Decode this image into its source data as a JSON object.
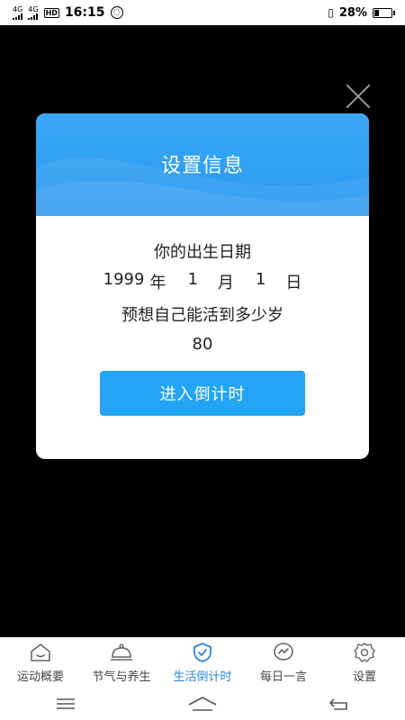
{
  "status_bar": {
    "network_1": "4G",
    "network_2": "4G",
    "hd_label": "HD",
    "time": "16:15",
    "battery_percent": "28%",
    "battery_level": 0.28
  },
  "dialog": {
    "title": "设置信息",
    "birth_label": "你的出生日期",
    "birth_year": "1999",
    "year_unit": "年",
    "birth_month": "1",
    "month_unit": "月",
    "birth_day": "1",
    "day_unit": "日",
    "age_label": "预想自己能活到多少岁",
    "age_value": "80",
    "enter_button": "进入倒计时"
  },
  "tabs": [
    {
      "label": "运动概要",
      "icon": "house-smile-icon",
      "active": false
    },
    {
      "label": "节气与养生",
      "icon": "cloche-icon",
      "active": false
    },
    {
      "label": "生活倒计时",
      "icon": "shield-check-icon",
      "active": true
    },
    {
      "label": "每日一言",
      "icon": "chat-bubble-icon",
      "active": false
    },
    {
      "label": "设置",
      "icon": "gear-icon",
      "active": false
    }
  ],
  "colors": {
    "accent": "#2a84e0",
    "header": "#2a98ef",
    "button": "#23a4f4"
  }
}
